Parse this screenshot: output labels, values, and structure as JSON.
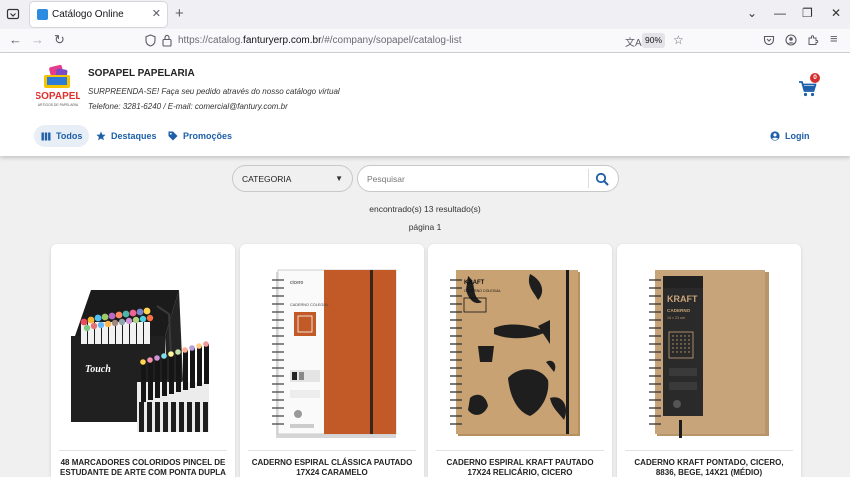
{
  "browser": {
    "tab_title": "Catálogo Online",
    "url_prefix": "https://catalog.",
    "url_domain": "fanturyerp.com.br",
    "url_path": "/#/company/sopapel/catalog-list",
    "zoom": "90%"
  },
  "store": {
    "logo_text": "SOPAPEL",
    "logo_subtext": "ARTIGOS DE PAPELARIA",
    "name": "SOPAPEL PAPELARIA",
    "tagline": "SURPREENDA-SE! Faça seu pedido através do nosso catálogo virtual",
    "contact": "Telefone: 3281-6240 / E-mail: comercial@fantury.com.br",
    "cart_count": "0"
  },
  "menu": {
    "all": "Todos",
    "featured": "Destaques",
    "promotions": "Promoções",
    "login": "Login"
  },
  "filters": {
    "category": "CATEGORIA",
    "search_placeholder": "Pesquisar"
  },
  "results": {
    "count_text": "encontrado(s) 13 resultado(s)",
    "page_text": "página 1"
  },
  "products": [
    {
      "title": "48 MARCADORES COLORIDOS PINCEL DE ESTUDANTE DE ARTE COM PONTA DUPLA"
    },
    {
      "title": "CADERNO ESPIRAL CLÁSSICA PAUTADO 17X24 CARAMELO"
    },
    {
      "title": "CADERNO ESPIRAL KRAFT PAUTADO 17X24 RELICÁRIO, CICERO"
    },
    {
      "title": "CADERNO KRAFT PONTADO, CICERO, 8836, BEGE, 14X21 (MÉDIO)"
    }
  ],
  "product_image_text": {
    "markers_brand": "Touch",
    "notebook1_brand": "cicero",
    "notebook1_label": "CADERNO COLEGIAL",
    "notebook2_brand": "KRAFT",
    "notebook2_label": "CADERNO COLEGIAL",
    "notebook3_brand": "KRAFT",
    "notebook3_label": "CADERNO",
    "notebook3_size": "14 × 21 cm"
  },
  "colors": {
    "primary": "#1d5fa8",
    "badge": "#d32f2f",
    "notebook_caramel": "#c25a28",
    "kraft": "#c9a273"
  }
}
